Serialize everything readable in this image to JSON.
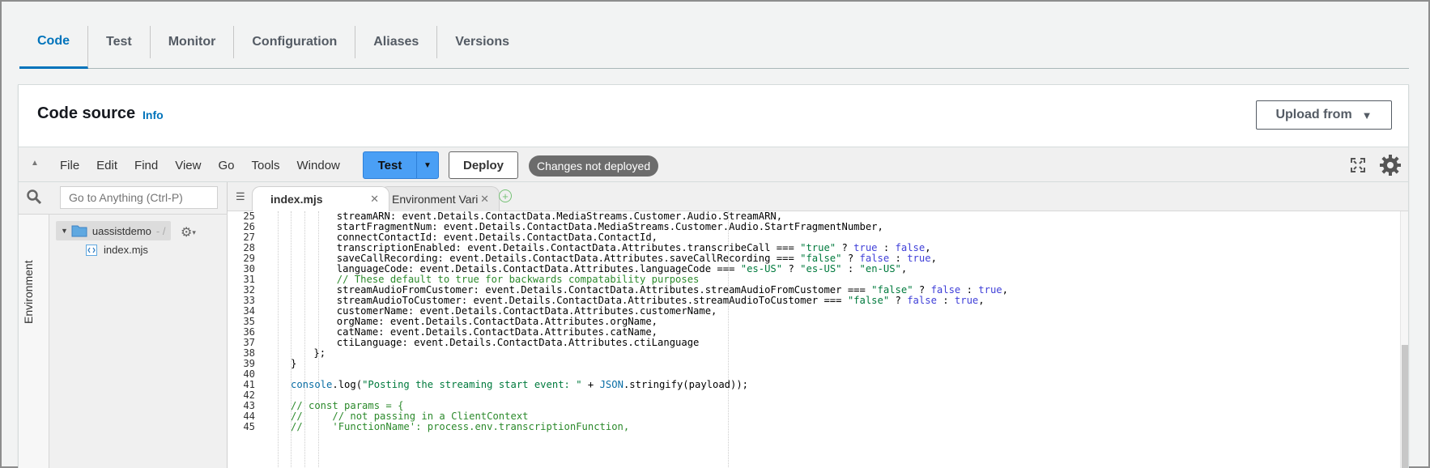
{
  "tabs": [
    "Code",
    "Test",
    "Monitor",
    "Configuration",
    "Aliases",
    "Versions"
  ],
  "active_tab": "Code",
  "panel": {
    "title": "Code source",
    "info": "Info",
    "upload_label": "Upload from"
  },
  "ide": {
    "menu": [
      "File",
      "Edit",
      "Find",
      "View",
      "Go",
      "Tools",
      "Window"
    ],
    "test_label": "Test",
    "deploy_label": "Deploy",
    "status_badge": "Changes not deployed"
  },
  "sidebar": {
    "search_placeholder": "Go to Anything (Ctrl-P)",
    "environment_label": "Environment",
    "root_folder": "uassistdemo",
    "root_path": "- /",
    "file": "index.mjs"
  },
  "editor": {
    "active_tab": "index.mjs",
    "inactive_tab": "Environment Vari",
    "lines": [
      {
        "n": "25",
        "indent": 4,
        "segments": [
          [
            "streamARN: event.Details.ContactData.MediaStreams.Customer.Audio.StreamARN,",
            ""
          ]
        ]
      },
      {
        "n": "26",
        "indent": 4,
        "segments": [
          [
            "startFragmentNum: event.Details.ContactData.MediaStreams.Customer.Audio.StartFragmentNumber,",
            ""
          ]
        ]
      },
      {
        "n": "27",
        "indent": 4,
        "segments": [
          [
            "connectContactId: event.Details.ContactData.ContactId,",
            ""
          ]
        ]
      },
      {
        "n": "28",
        "indent": 4,
        "segments": [
          [
            "transcriptionEnabled: event.Details.ContactData.Attributes.transcribeCall === ",
            ""
          ],
          [
            "\"true\"",
            "str"
          ],
          [
            " ? ",
            ""
          ],
          [
            "true",
            "kw"
          ],
          [
            " : ",
            ""
          ],
          [
            "false",
            "kw"
          ],
          [
            ",",
            ""
          ]
        ]
      },
      {
        "n": "29",
        "indent": 4,
        "segments": [
          [
            "saveCallRecording: event.Details.ContactData.Attributes.saveCallRecording === ",
            ""
          ],
          [
            "\"false\"",
            "str"
          ],
          [
            " ? ",
            ""
          ],
          [
            "false",
            "kw"
          ],
          [
            " : ",
            ""
          ],
          [
            "true",
            "kw"
          ],
          [
            ",",
            ""
          ]
        ]
      },
      {
        "n": "30",
        "indent": 4,
        "segments": [
          [
            "languageCode: event.Details.ContactData.Attributes.languageCode === ",
            ""
          ],
          [
            "\"es-US\"",
            "str"
          ],
          [
            " ? ",
            ""
          ],
          [
            "\"es-US\"",
            "str"
          ],
          [
            " : ",
            ""
          ],
          [
            "\"en-US\"",
            "str"
          ],
          [
            ",",
            ""
          ]
        ]
      },
      {
        "n": "31",
        "indent": 4,
        "segments": [
          [
            "// These default to true for backwards compatability purposes",
            "cm"
          ]
        ]
      },
      {
        "n": "32",
        "indent": 4,
        "segments": [
          [
            "streamAudioFromCustomer: event.Details.ContactData.Attributes.streamAudioFromCustomer === ",
            ""
          ],
          [
            "\"false\"",
            "str"
          ],
          [
            " ? ",
            ""
          ],
          [
            "false",
            "kw"
          ],
          [
            " : ",
            ""
          ],
          [
            "true",
            "kw"
          ],
          [
            ",",
            ""
          ]
        ]
      },
      {
        "n": "33",
        "indent": 4,
        "segments": [
          [
            "streamAudioToCustomer: event.Details.ContactData.Attributes.streamAudioToCustomer === ",
            ""
          ],
          [
            "\"false\"",
            "str"
          ],
          [
            " ? ",
            ""
          ],
          [
            "false",
            "kw"
          ],
          [
            " : ",
            ""
          ],
          [
            "true",
            "kw"
          ],
          [
            ",",
            ""
          ]
        ]
      },
      {
        "n": "34",
        "indent": 4,
        "segments": [
          [
            "customerName: event.Details.ContactData.Attributes.customerName,",
            ""
          ]
        ]
      },
      {
        "n": "35",
        "indent": 4,
        "segments": [
          [
            "orgName: event.Details.ContactData.Attributes.orgName,",
            ""
          ]
        ]
      },
      {
        "n": "36",
        "indent": 4,
        "segments": [
          [
            "catName: event.Details.ContactData.Attributes.catName,",
            ""
          ]
        ]
      },
      {
        "n": "37",
        "indent": 4,
        "segments": [
          [
            "ctiLanguage: event.Details.ContactData.Attributes.ctiLanguage",
            ""
          ]
        ]
      },
      {
        "n": "38",
        "indent": 2,
        "segments": [
          [
            "};",
            ""
          ]
        ]
      },
      {
        "n": "39",
        "indent": 0,
        "segments": [
          [
            "}",
            ""
          ]
        ]
      },
      {
        "n": "40",
        "indent": 0,
        "segments": [
          [
            "",
            ""
          ]
        ]
      },
      {
        "n": "41",
        "indent": 0,
        "segments": [
          [
            "console",
            "fn"
          ],
          [
            ".log(",
            ""
          ],
          [
            "\"Posting the streaming start event: \"",
            "str"
          ],
          [
            " + ",
            ""
          ],
          [
            "JSON",
            "fn"
          ],
          [
            ".stringify(payload));",
            ""
          ]
        ]
      },
      {
        "n": "42",
        "indent": 0,
        "segments": [
          [
            "",
            ""
          ]
        ]
      },
      {
        "n": "43",
        "indent": 0,
        "segments": [
          [
            "// const params = {",
            "cm"
          ]
        ]
      },
      {
        "n": "44",
        "indent": 0,
        "segments": [
          [
            "//     // not passing in a ClientContext",
            "cm"
          ]
        ]
      },
      {
        "n": "45",
        "indent": 0,
        "segments": [
          [
            "//     'FunctionName': process.env.transcriptionFunction,",
            "cm"
          ]
        ]
      }
    ]
  }
}
